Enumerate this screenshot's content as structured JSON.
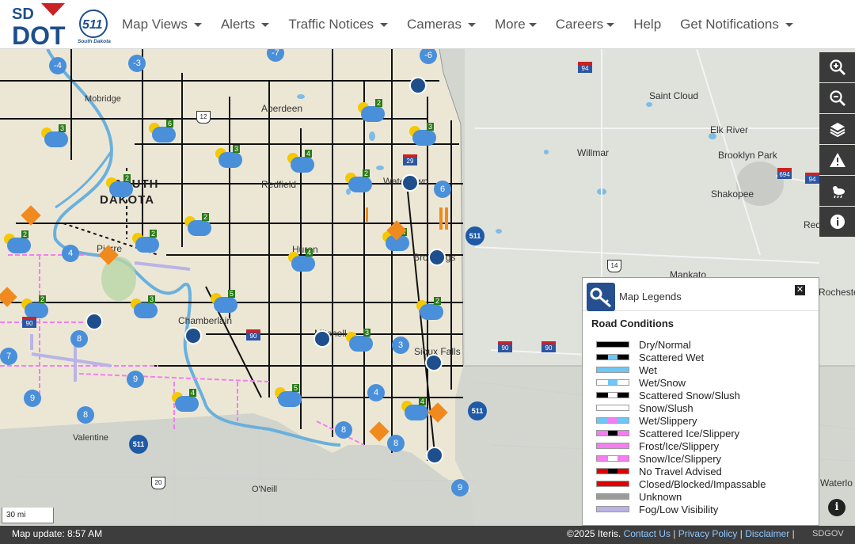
{
  "nav": {
    "logo_sd": "SD",
    "logo_dot": "DOT",
    "logo_511": "511",
    "logo_511_sub": "South Dakota",
    "items": [
      {
        "label": "Map Views",
        "dropdown": true
      },
      {
        "label": "Alerts",
        "dropdown": true
      },
      {
        "label": "Traffic Notices",
        "dropdown": true
      },
      {
        "label": "Cameras",
        "dropdown": true
      },
      {
        "label": "More",
        "dropdown": true
      },
      {
        "label": "Careers",
        "dropdown": true
      },
      {
        "label": "Help",
        "dropdown": false
      },
      {
        "label": "Get Notifications",
        "dropdown": true
      }
    ]
  },
  "toolbar": {
    "buttons": [
      {
        "name": "zoom-in",
        "icon": "zoom-in-icon"
      },
      {
        "name": "zoom-out",
        "icon": "zoom-out-icon"
      },
      {
        "name": "layers",
        "icon": "layers-icon"
      },
      {
        "name": "alerts",
        "icon": "warning-icon"
      },
      {
        "name": "weather",
        "icon": "weather-icon"
      },
      {
        "name": "info",
        "icon": "info-icon"
      }
    ]
  },
  "legend": {
    "title": "Map Legends",
    "close": "✕",
    "section": "Road Conditions",
    "items": [
      {
        "label": "Dry/Normal",
        "color": "#000000",
        "accent": null
      },
      {
        "label": "Scattered Wet",
        "color": "#000000",
        "accent": "#6ec6f5"
      },
      {
        "label": "Wet",
        "color": "#6ec6f5",
        "accent": null
      },
      {
        "label": "Wet/Snow",
        "color": "#ffffff",
        "accent": "#6ec6f5"
      },
      {
        "label": "Scattered Snow/Slush",
        "color": "#000000",
        "accent": "#ffffff"
      },
      {
        "label": "Snow/Slush",
        "color": "#ffffff",
        "accent": null
      },
      {
        "label": "Wet/Slippery",
        "color": "#6ec6f5",
        "accent": "#f37ef0"
      },
      {
        "label": "Scattered Ice/Slippery",
        "color": "#f37ef0",
        "accent": "#000000"
      },
      {
        "label": "Frost/Ice/Slippery",
        "color": "#f37ef0",
        "accent": null
      },
      {
        "label": "Snow/Ice/Slippery",
        "color": "#f37ef0",
        "accent": "#ffffff"
      },
      {
        "label": "No Travel Advised",
        "color": "#e00000",
        "accent": "#000000"
      },
      {
        "label": "Closed/Blocked/Impassable",
        "color": "#e00000",
        "accent": null
      },
      {
        "label": "Unknown",
        "color": "#9a9a9a",
        "accent": null
      },
      {
        "label": "Fog/Low Visibility",
        "color": "#b9b3e6",
        "accent": null
      }
    ],
    "info": "i"
  },
  "map": {
    "state_label_1": "SOUTH",
    "state_label_2": "DAKOTA",
    "cities": [
      "Mobridge",
      "Aberdeen",
      "Redfield",
      "Watertown",
      "Pierre",
      "Huron",
      "Brookings",
      "Chamberlain",
      "Mitchell",
      "Sioux Falls",
      "Valentine",
      "O'Neill",
      "Saint Cloud",
      "Elk River",
      "Willmar",
      "Brooklyn Park",
      "Shakopee",
      "Red",
      "Mankato",
      "Rochester",
      "Waterlo"
    ],
    "scale": "30 mi"
  },
  "footer": {
    "map_update": "Map update: 8:57 AM",
    "copyright": "©2025 Iteris.",
    "contact": "Contact Us",
    "privacy": "Privacy Policy",
    "disclaimer": "Disclaimer",
    "sep": "|",
    "sdgov": "SDGOV"
  }
}
